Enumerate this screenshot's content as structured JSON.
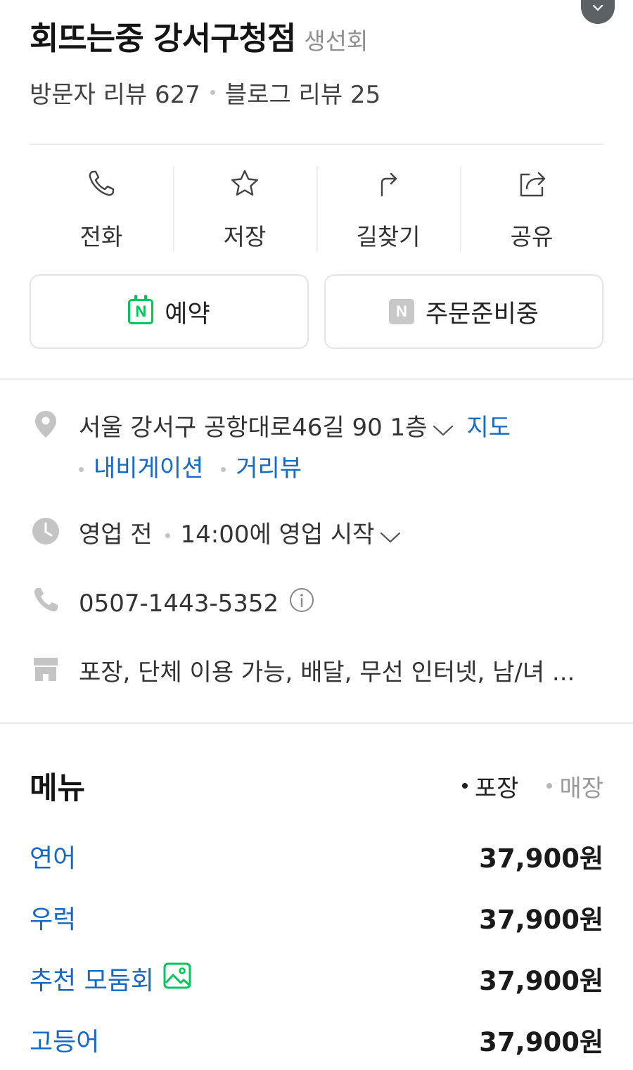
{
  "place": {
    "name": "회뜨는중 강서구청점",
    "category": "생선회",
    "visitor_reviews": "방문자 리뷰 627",
    "blog_reviews": "블로그 리뷰 25"
  },
  "actions": [
    {
      "label": "전화",
      "icon": "phone-icon"
    },
    {
      "label": "저장",
      "icon": "star-icon"
    },
    {
      "label": "길찾기",
      "icon": "directions-icon"
    },
    {
      "label": "공유",
      "icon": "share-icon"
    }
  ],
  "buttons": {
    "reserve": {
      "label": "예약",
      "badge": "N"
    },
    "order": {
      "label": "주문준비중",
      "badge": "N"
    }
  },
  "info": {
    "address": "서울 강서구 공항대로46길 90 1층",
    "map_link": "지도",
    "navigation_link": "내비게이션",
    "streetview_link": "거리뷰",
    "hours_status": "영업 전",
    "hours_detail": "14:00에 영업 시작",
    "phone": "0507-1443-5352",
    "amenities": "포장, 단체 이용 가능, 배달, 무선 인터넷, 남/녀 ..."
  },
  "menu": {
    "title": "메뉴",
    "tab_takeout": "포장",
    "tab_dinein": "매장",
    "items": [
      {
        "name": "연어",
        "price": "37,900원"
      },
      {
        "name": "우럭",
        "price": "37,900원"
      },
      {
        "name": "추천 모둠회",
        "price": "37,900원"
      },
      {
        "name": "고등어",
        "price": "37,900원"
      }
    ]
  },
  "colors": {
    "link": "#1569c7",
    "naver_green": "#03c75a"
  }
}
